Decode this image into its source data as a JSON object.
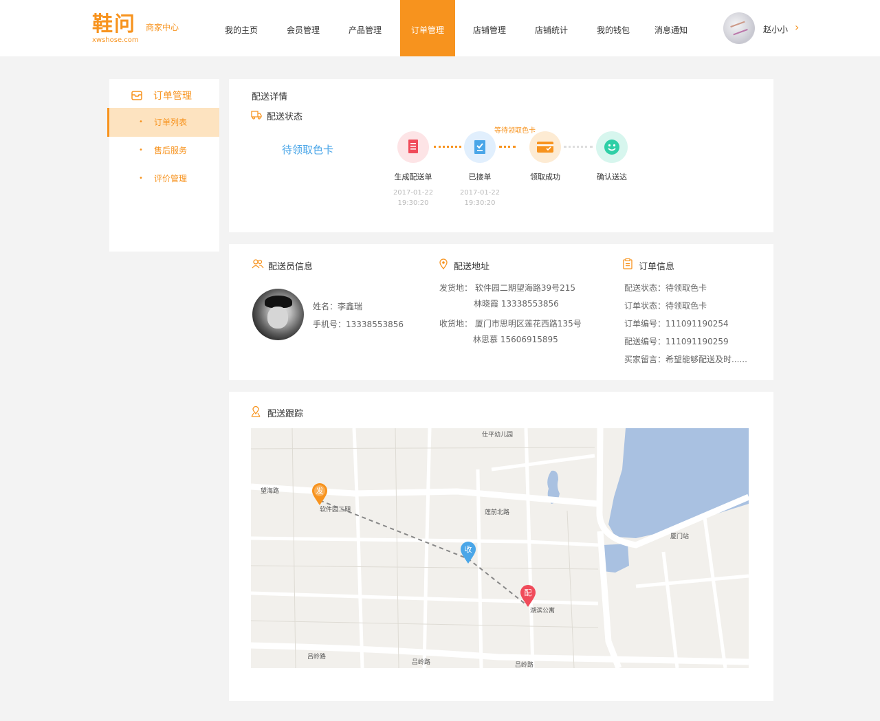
{
  "brand": {
    "name": "鞋问",
    "subtitle": "商家中心",
    "url": "xwshose.com",
    "accent": "#f7931e",
    "blue": "#4aa6e8"
  },
  "nav": {
    "items": [
      {
        "label": "我的主页"
      },
      {
        "label": "会员管理"
      },
      {
        "label": "产品管理"
      },
      {
        "label": "订单管理",
        "active": true
      },
      {
        "label": "店铺管理"
      },
      {
        "label": "店铺统计"
      },
      {
        "label": "我的钱包"
      },
      {
        "label": "消息通知"
      }
    ]
  },
  "user": {
    "name": "赵小小",
    "chevron": "›"
  },
  "sidebar": {
    "title": "订单管理",
    "items": [
      {
        "label": "订单列表",
        "active": true
      },
      {
        "label": "售后服务"
      },
      {
        "label": "评价管理"
      }
    ],
    "dot": "•"
  },
  "delivery": {
    "title": "配送详情",
    "status_title": "配送状态",
    "current_status": "待领取色卡",
    "waiting_label": "等待领取色卡",
    "steps": [
      {
        "name": "生成配送单",
        "date": "2017-01-22",
        "time": "19:30:20",
        "icon": "document-icon",
        "color": "#f04b5a"
      },
      {
        "name": "已接单",
        "date": "2017-01-22",
        "time": "19:30:20",
        "icon": "checklist-icon",
        "color": "#4aa6e8"
      },
      {
        "name": "领取成功",
        "date": "",
        "time": "",
        "icon": "card-icon",
        "color": "#f7931e"
      },
      {
        "name": "确认送达",
        "date": "",
        "time": "",
        "icon": "smile-icon",
        "color": "#2ecfa6"
      }
    ]
  },
  "courier": {
    "title": "配送员信息",
    "name_label": "姓名：",
    "name": "李鑫瑞",
    "phone_label": "手机号：",
    "phone": "13338553856"
  },
  "address": {
    "title": "配送地址",
    "from_label": "发货地：",
    "from_address": "软件园二期望海路39号215",
    "from_contact": "林晓霞  13338553856",
    "to_label": "收货地：",
    "to_address": "厦门市思明区莲花西路135号",
    "to_contact": "林思慕  15606915895"
  },
  "order": {
    "title": "订单信息",
    "lines": [
      "配送状态：待领取色卡",
      "订单状态：待领取色卡",
      "订单编号：111091190254",
      "配送编号：111091190259",
      "买家留言：希望能够配送及时......"
    ]
  },
  "tracking": {
    "title": "配送跟踪",
    "markers": [
      {
        "label": "发",
        "color": "#f7931e"
      },
      {
        "label": "收",
        "color": "#4aa6e8"
      },
      {
        "label": "配",
        "color": "#f04b5a"
      }
    ],
    "map_labels": [
      "仕平幼儿园",
      "吕岭路",
      "吕岭路",
      "吕岭路",
      "湖滨公寓",
      "莲前北路",
      "望海路",
      "软件园二期",
      "厦门站"
    ]
  }
}
